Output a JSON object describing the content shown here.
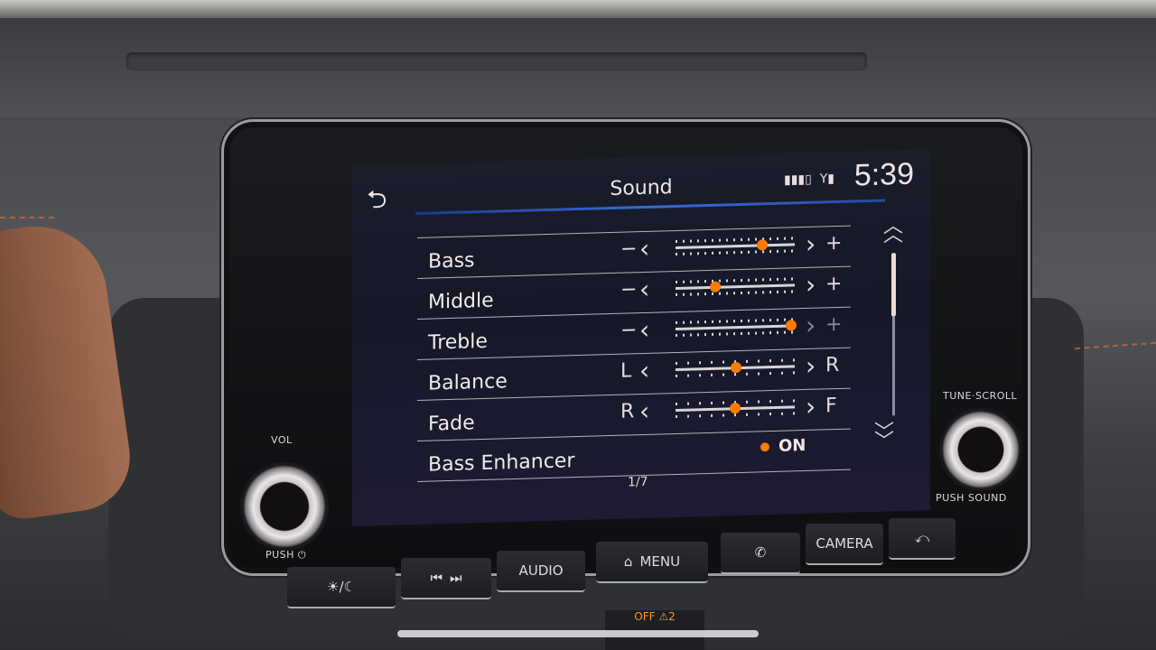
{
  "screen": {
    "title": "Sound",
    "clock": "5:39",
    "status_icons": [
      "battery-icon",
      "signal-icon"
    ],
    "back_icon": "back-arrow-icon",
    "page_indicator": "1/7",
    "scroll": {
      "position_fraction": 0.0,
      "visible_fraction": 0.39
    }
  },
  "settings": [
    {
      "label": "Bass",
      "type": "slider",
      "left": "−",
      "right": "+",
      "value_fraction": 0.73
    },
    {
      "label": "Middle",
      "type": "slider",
      "left": "−",
      "right": "+",
      "value_fraction": 0.33
    },
    {
      "label": "Treble",
      "type": "slider",
      "left": "−",
      "right": "+",
      "value_fraction": 0.97
    },
    {
      "label": "Balance",
      "type": "slider",
      "left": "L",
      "right": "R",
      "value_fraction": 0.51
    },
    {
      "label": "Fade",
      "type": "slider",
      "left": "R",
      "right": "F",
      "value_fraction": 0.5
    },
    {
      "label": "Bass Enhancer",
      "type": "toggle",
      "state": "ON"
    }
  ],
  "hardware": {
    "vol_label": "VOL",
    "vol_push_label": "PUSH ⏻",
    "tune_label": "TUNE·SCROLL",
    "tune_push_label": "PUSH SOUND",
    "buttons": {
      "day_night": "☀/☾",
      "prev": "⏮",
      "next": "⏭",
      "audio": "AUDIO",
      "menu_icon": "⌂",
      "menu": "MENU",
      "phone": "✆",
      "camera": "CAMERA",
      "back": "⤺"
    },
    "airbag_text": "OFF ⚠2"
  },
  "colors": {
    "accent": "#ff7a00",
    "header_line": "#3a6ad8"
  }
}
